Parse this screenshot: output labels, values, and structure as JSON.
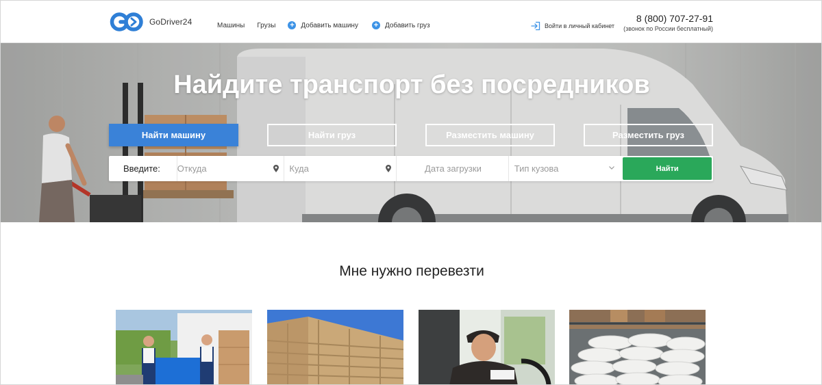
{
  "brand": {
    "name": "GoDriver24",
    "mark": "GO"
  },
  "nav": {
    "items": [
      {
        "label": "Машины"
      },
      {
        "label": "Грузы"
      }
    ],
    "actions": [
      {
        "label": "Добавить машину"
      },
      {
        "label": "Добавить груз"
      }
    ]
  },
  "login": {
    "label": "Войти в личный кабинет"
  },
  "contact": {
    "phone": "8 (800) 707-27-91",
    "note": "(звонок по России бесплатный)"
  },
  "hero": {
    "title": "Найдите транспорт без посредников",
    "tabs": [
      {
        "label": "Найти машину",
        "active": true
      },
      {
        "label": "Найти груз",
        "active": false
      },
      {
        "label": "Разместить машину",
        "active": false
      },
      {
        "label": "Разместить груз",
        "active": false
      }
    ]
  },
  "search": {
    "label": "Введите:",
    "from_placeholder": "Откуда",
    "to_placeholder": "Куда",
    "date_placeholder": "Дата загрузки",
    "body_type_placeholder": "Тип кузова",
    "submit_label": "Найти"
  },
  "section": {
    "title": "Мне нужно перевезти",
    "cards": [
      {
        "image": "movers-with-sofa"
      },
      {
        "image": "lumber-stack"
      },
      {
        "image": "driver-in-van"
      },
      {
        "image": "warehouse-sacks"
      }
    ]
  },
  "colors": {
    "accent": "#3a82d8",
    "search_button": "#2aa85a",
    "plus_icon": "#3d93e6"
  }
}
